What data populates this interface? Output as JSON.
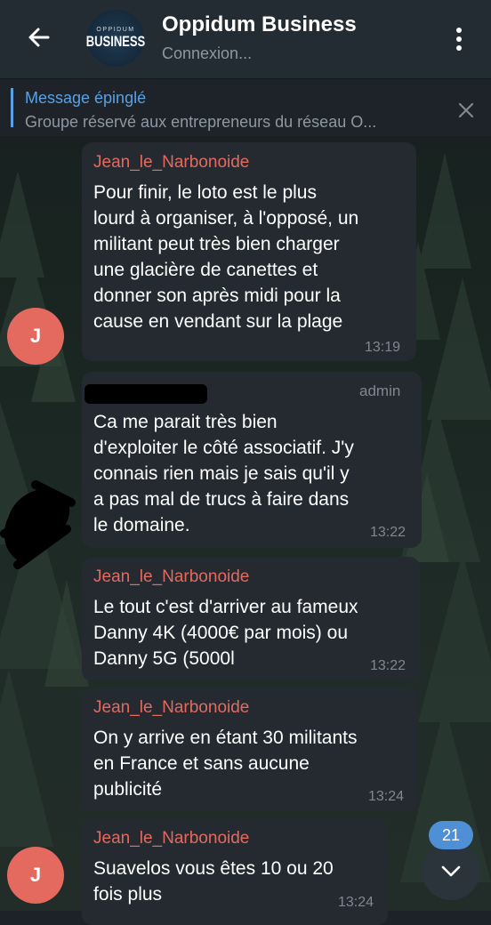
{
  "header": {
    "title": "Oppidum Business",
    "status": "Connexion...",
    "logo_top": "OPPIDUM",
    "logo_bottom": "BUSINESS"
  },
  "pinned": {
    "title": "Message épinglé",
    "text": "Groupe réservé aux entrepreneurs du réseau O..."
  },
  "messages": [
    {
      "sender": "Jean_le_Narbonoide",
      "lines": [
        "Pour finir, le loto est le plus",
        "lourd à organiser, à l'opposé, un",
        "militant peut très bien charger",
        "une glacière de canettes et",
        "donner son après midi pour la",
        "cause en vendant sur la plage"
      ],
      "time": "13:19",
      "avatar": "J"
    },
    {
      "role": "admin",
      "lines": [
        "Ca me parait très bien",
        "d'exploiter le côté associatif. J'y",
        "connais rien mais je sais qu'il y",
        "a pas mal de trucs à faire dans",
        "le domaine."
      ],
      "time": "13:22"
    },
    {
      "sender": "Jean_le_Narbonoide",
      "lines": [
        "Le tout c'est d'arriver au fameux",
        "Danny 4K (4000€ par mois) ou",
        "Danny 5G (5000l"
      ],
      "time": "13:22"
    },
    {
      "sender": "Jean_le_Narbonoide",
      "lines": [
        "On y arrive en étant 30 militants",
        "en France et sans aucune",
        "publicité"
      ],
      "time": "13:24"
    },
    {
      "sender": "Jean_le_Narbonoide",
      "lines": [
        "Suavelos vous êtes 10 ou 20",
        "fois plus"
      ],
      "time": "13:24",
      "avatar": "J"
    }
  ],
  "unread_badge": "21",
  "colors": {
    "accent": "#5aa1e3",
    "sender_name": "#e46a5f",
    "avatar": "#e46a5f",
    "bubble": "#242a30",
    "header": "#232b33"
  },
  "icons": {
    "back": "arrow-left-icon",
    "menu": "kebab-menu-icon",
    "pinned_close": "close-icon",
    "scroll_down": "chevron-down-icon"
  }
}
